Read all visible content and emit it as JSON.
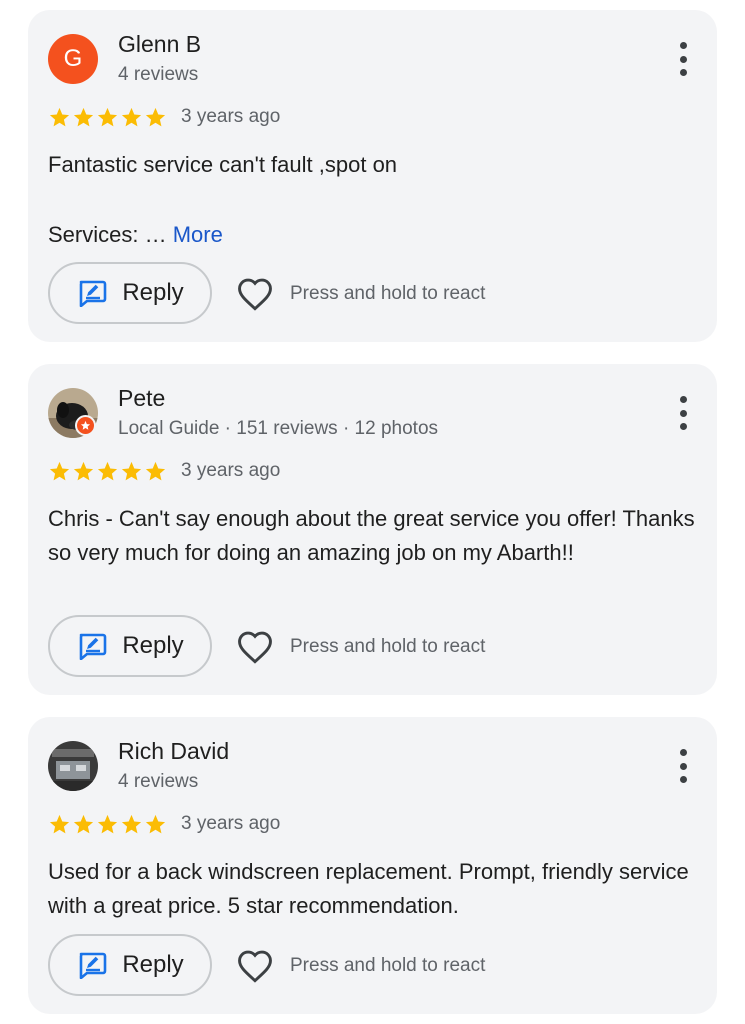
{
  "reviews": [
    {
      "avatar_letter": "G",
      "name": "Glenn B",
      "meta": "4 reviews",
      "rating": 5,
      "time": "3 years ago",
      "text": "Fantastic service can't fault ,spot on",
      "services_prefix": "Services: … ",
      "more_label": "More",
      "reply_label": "Reply",
      "react_label": "Press and hold to react"
    },
    {
      "name": "Pete",
      "meta": "Local Guide · 151 reviews · 12 photos",
      "rating": 5,
      "time": "3 years ago",
      "text": "Chris - Can't say enough about the great service you offer! Thanks so very much for doing an amazing job on my Abarth!!",
      "reply_label": "Reply",
      "react_label": "Press and hold to react"
    },
    {
      "name": "Rich David",
      "meta": "4 reviews",
      "rating": 5,
      "time": "3 years ago",
      "text": "Used for a back windscreen replacement. Prompt, friendly service with a great price. 5 star recommendation.",
      "reply_label": "Reply",
      "react_label": "Press and hold to react"
    }
  ],
  "icons": {
    "star": "star-icon",
    "reply": "reply-icon",
    "react": "heart-icon",
    "menu": "more-vert-icon",
    "local_guide": "local-guide-badge-icon"
  },
  "colors": {
    "card_bg": "#f3f4f6",
    "star": "#fbbc04",
    "link": "#1a57c9",
    "reply_icon": "#1a73e8",
    "avatar_glenn": "#f4511e",
    "guide_badge": "#f4511e"
  }
}
